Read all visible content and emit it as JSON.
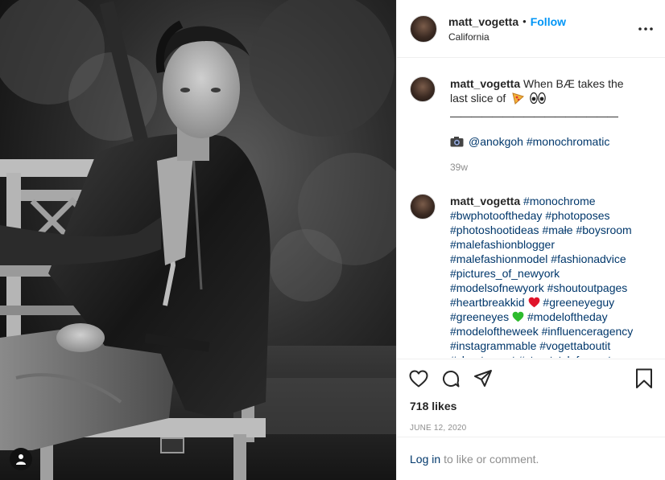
{
  "post": {
    "username": "matt_vogetta",
    "separator": "•",
    "follow_label": "Follow",
    "location": "California"
  },
  "caption": {
    "username": "matt_vogetta",
    "text": "When BÆ takes the last slice of",
    "emoji": [
      "pizza",
      "eyes"
    ],
    "divider": "————————————————",
    "credit_icon": "camera-icon",
    "credit_handle": "@anokgoh",
    "credit_tag": "#monochromatic",
    "age": "39w"
  },
  "tags_comment": {
    "username": "matt_vogetta",
    "segments": [
      {
        "t": "#monochrome",
        "type": "link"
      },
      {
        "t": "#bwphotooftheday",
        "type": "link"
      },
      {
        "t": "#photoposes",
        "type": "link"
      },
      {
        "t": "#photoshootideas",
        "type": "link"
      },
      {
        "t": "#małe",
        "type": "link"
      },
      {
        "t": "#boysroom",
        "type": "link"
      },
      {
        "t": "#malefashionblogger",
        "type": "link"
      },
      {
        "t": "#malefashionmodel",
        "type": "link"
      },
      {
        "t": "#fashionadvice",
        "type": "link"
      },
      {
        "t": "#pictures_of_newyork",
        "type": "link"
      },
      {
        "t": "#modelsofnewyork",
        "type": "link"
      },
      {
        "t": "#shoutoutpages",
        "type": "link"
      },
      {
        "t": "#heartbreakkid",
        "type": "link"
      },
      {
        "t": "red-heart",
        "type": "emoji"
      },
      {
        "t": "#greeneyeguy",
        "type": "link"
      },
      {
        "t": "#greeneyes",
        "type": "link"
      },
      {
        "t": "green-heart",
        "type": "emoji"
      },
      {
        "t": "#modeloftheday",
        "type": "link"
      },
      {
        "t": "#modeloftheweek",
        "type": "link"
      },
      {
        "t": "#influenceragency",
        "type": "link"
      },
      {
        "t": "#instagrammable",
        "type": "link"
      },
      {
        "t": "#vogettaboutit",
        "type": "link"
      },
      {
        "t": "#shoutmeout",
        "type": "link"
      },
      {
        "t": "#streetstyleforgents",
        "type": "link"
      },
      {
        "t": "#streetstylephotography",
        "type": "link"
      }
    ]
  },
  "actions": {
    "icons": [
      "heart-icon",
      "comment-icon",
      "share-icon",
      "bookmark-icon"
    ],
    "likes": "718 likes",
    "date": "JUNE 12, 2020"
  },
  "login": {
    "link": "Log in",
    "rest": "to like or comment."
  },
  "colors": {
    "follow": "#0095f6",
    "link": "#00376b",
    "muted": "#8e8e8e",
    "border": "#efefef"
  }
}
